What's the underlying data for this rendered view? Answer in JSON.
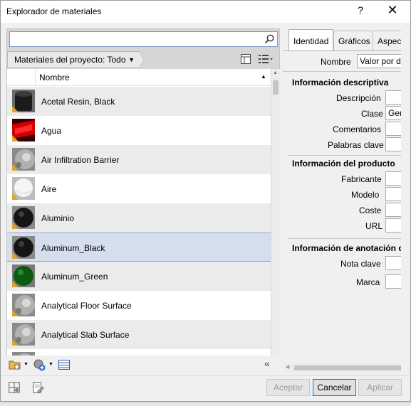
{
  "window": {
    "title": "Explorador de materiales",
    "help_label": "?",
    "close_label": "✕"
  },
  "search": {
    "value": "",
    "placeholder": ""
  },
  "filter": {
    "label": "Materiales del proyecto: Todo"
  },
  "table": {
    "column_name": "Nombre",
    "sort_indicator": "▲",
    "rows": [
      {
        "name": "Acetal Resin, Black",
        "swatch": "black-cylinder"
      },
      {
        "name": "Agua",
        "swatch": "red-water"
      },
      {
        "name": "Air Infiltration Barrier",
        "swatch": "gray-sphere"
      },
      {
        "name": "Aire",
        "swatch": "light-sphere"
      },
      {
        "name": "Aluminio",
        "swatch": "black-sphere"
      },
      {
        "name": "Aluminum_Black",
        "swatch": "black-sphere"
      },
      {
        "name": "Aluminum_Green",
        "swatch": "green-sphere"
      },
      {
        "name": "Analytical Floor Surface",
        "swatch": "gray-sphere"
      },
      {
        "name": "Analytical Slab Surface",
        "swatch": "gray-sphere"
      },
      {
        "name": "",
        "swatch": "gray-sphere"
      }
    ],
    "selected_index": 5
  },
  "tabs": [
    {
      "label": "Identidad",
      "active": true
    },
    {
      "label": "Gráficos",
      "active": false
    },
    {
      "label": "Aspecto",
      "active": false
    }
  ],
  "identity": {
    "name_label": "Nombre",
    "name_value": "Valor por defecto",
    "sections": [
      {
        "title": "Información descriptiva",
        "fields": [
          {
            "label": "Descripción",
            "value": ""
          },
          {
            "label": "Clase",
            "value": "Genérico"
          },
          {
            "label": "Comentarios",
            "value": ""
          },
          {
            "label": "Palabras clave",
            "value": ""
          }
        ]
      },
      {
        "title": "Información del producto",
        "fields": [
          {
            "label": "Fabricante",
            "value": ""
          },
          {
            "label": "Modelo",
            "value": ""
          },
          {
            "label": "Coste",
            "value": ""
          },
          {
            "label": "URL",
            "value": ""
          }
        ]
      },
      {
        "title": "Información de anotación de material",
        "fields": [
          {
            "label": "Nota clave",
            "value": ""
          },
          {
            "label": "Marca",
            "value": ""
          }
        ]
      }
    ]
  },
  "buttons": {
    "accept": "Aceptar",
    "cancel": "Cancelar",
    "apply": "Aplicar"
  },
  "colors": {
    "selection": "#d5deec",
    "warning": "#e0a42a",
    "focus": "#0078d7"
  }
}
